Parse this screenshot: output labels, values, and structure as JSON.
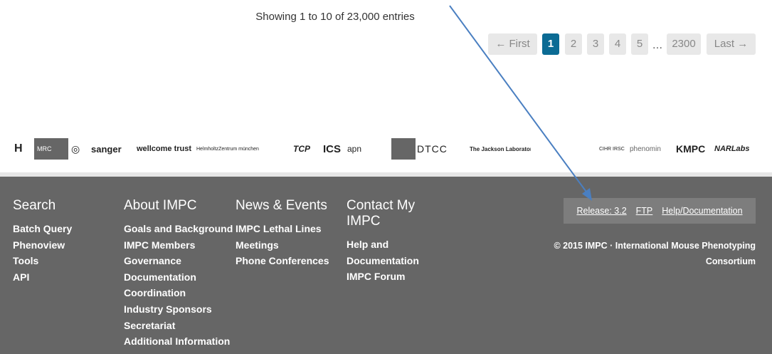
{
  "table_info": {
    "text": "Showing 1 to 10 of 23,000 entries"
  },
  "pagination": {
    "first_label": "← First",
    "pages": [
      "1",
      "2",
      "3",
      "4",
      "5"
    ],
    "active_page": "1",
    "ellipsis": "…",
    "last_page": "2300",
    "last_label": "Last →"
  },
  "partner_logos": [
    {
      "name": "h-logo",
      "text": "H"
    },
    {
      "name": "mrc-logo",
      "text": "MRC"
    },
    {
      "name": "seal-logo",
      "text": "◎"
    },
    {
      "name": "sanger-logo",
      "text": "sanger"
    },
    {
      "name": "wellcome-trust-logo",
      "text": "wellcome trust"
    },
    {
      "name": "helmholtz-logo",
      "text": "HelmholtzZentrum münchen"
    },
    {
      "name": "tcp-logo",
      "text": "TCP"
    },
    {
      "name": "ics-logo",
      "text": "ICS"
    },
    {
      "name": "apn-logo",
      "text": "apn"
    },
    {
      "name": "eu-flag-logo",
      "text": ""
    },
    {
      "name": "dtcc-logo",
      "text": "DTCC"
    },
    {
      "name": "jax-logo",
      "text": "The Jackson Laboratory"
    },
    {
      "name": "genome-canada-logo",
      "text": ""
    },
    {
      "name": "riken-logo",
      "text": ""
    },
    {
      "name": "cihr-logo",
      "text": "CIHR IRSC"
    },
    {
      "name": "phenomin-logo",
      "text": "phenomin"
    },
    {
      "name": "kmpc-logo",
      "text": "KMPC"
    },
    {
      "name": "narlabs-logo",
      "text": "NARLabs"
    }
  ],
  "footer": {
    "search": {
      "heading": "Search",
      "links": [
        "Batch Query",
        "Phenoview",
        "Tools",
        "API"
      ]
    },
    "about": {
      "heading": "About IMPC",
      "links": [
        "Goals and Background",
        "IMPC Members",
        "Governance",
        "Documentation",
        "Coordination",
        "Industry Sponsors",
        "Secretariat",
        "Additional Information"
      ]
    },
    "news": {
      "heading": "News & Events",
      "links": [
        "IMPC Lethal Lines",
        "Meetings",
        "Phone Conferences"
      ]
    },
    "contact": {
      "heading": "Contact My IMPC",
      "links": [
        "Help and Documentation",
        "IMPC Forum"
      ]
    },
    "release_label": "Release: 3.2",
    "ftp_label": "FTP",
    "help_label": "Help/Documentation",
    "copyright": "© 2015 IMPC · International Mouse Phenotyping Consortium"
  },
  "colors": {
    "active_page": "#0b6b94",
    "footer_bg": "#666666",
    "annotation_arrow": "#4a7fc1"
  }
}
